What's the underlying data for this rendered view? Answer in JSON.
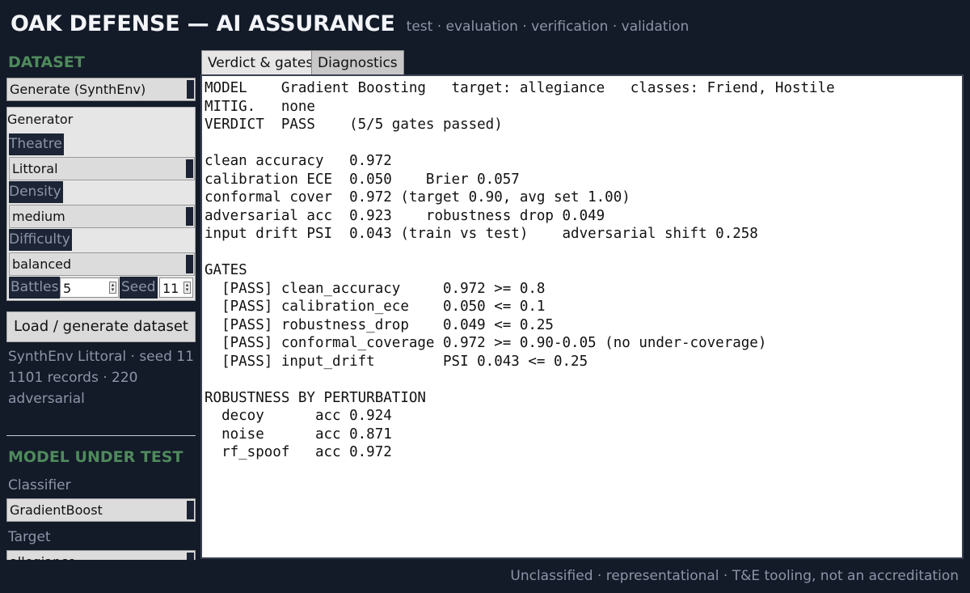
{
  "header": {
    "title": "OAK DEFENSE — AI ASSURANCE",
    "subtitle": "test · evaluation · verification · validation"
  },
  "dataset": {
    "section_title": "DATASET",
    "source_select": "Generate (SynthEnv)",
    "generator_legend": "Generator",
    "theatre_label": "Theatre",
    "theatre_value": "Littoral",
    "density_label": "Density",
    "density_value": "medium",
    "difficulty_label": "Difficulty",
    "difficulty_value": "balanced",
    "battles_label": "Battles",
    "battles_value": "5",
    "seed_label": "Seed",
    "seed_value": "11",
    "load_button": "Load / generate dataset",
    "status": "SynthEnv Littoral · seed 11\n1101 records · 220 adversarial"
  },
  "model": {
    "section_title": "MODEL UNDER TEST",
    "classifier_label": "Classifier",
    "classifier_value": "GradientBoost",
    "target_label": "Target",
    "target_value": "allegiance"
  },
  "tabs": [
    {
      "label": "Verdict & gates",
      "active": true
    },
    {
      "label": "Diagnostics",
      "active": false
    }
  ],
  "report": {
    "text": "MODEL    Gradient Boosting   target: allegiance   classes: Friend, Hostile\nMITIG.   none\nVERDICT  PASS    (5/5 gates passed)\n\nclean accuracy   0.972\ncalibration ECE  0.050    Brier 0.057\nconformal cover  0.972 (target 0.90, avg set 1.00)\nadversarial acc  0.923    robustness drop 0.049\ninput drift PSI  0.043 (train vs test)    adversarial shift 0.258\n\nGATES\n  [PASS] clean_accuracy     0.972 >= 0.8\n  [PASS] calibration_ece    0.050 <= 0.1\n  [PASS] robustness_drop    0.049 <= 0.25\n  [PASS] conformal_coverage 0.972 >= 0.90-0.05 (no under-coverage)\n  [PASS] input_drift        PSI 0.043 <= 0.25\n\nROBUSTNESS BY PERTURBATION\n  decoy      acc 0.924\n  noise      acc 0.871\n  rf_spoof   acc 0.972"
  },
  "footer": {
    "text": "Unclassified · representational · T&E tooling, not an accreditation"
  }
}
